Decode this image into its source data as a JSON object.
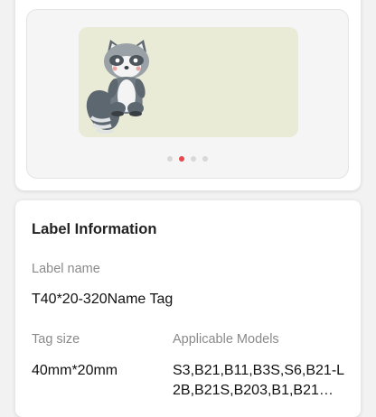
{
  "preview": {
    "image_name": "raccoon-label-preview",
    "label_background": "#e9ebd6",
    "pager": {
      "total": 4,
      "active": 2
    },
    "active_dot_color": "#e5484d"
  },
  "info": {
    "title": "Label Information",
    "label_name_label": "Label name",
    "label_name_value": "T40*20-320Name Tag",
    "tag_size_label": "Tag size",
    "tag_size_value": "40mm*20mm",
    "models_label": "Applicable Models",
    "models_value": "S3,B21,B11,B3S,S6,B21-L2B,B21S,B203,B1,B21…"
  }
}
